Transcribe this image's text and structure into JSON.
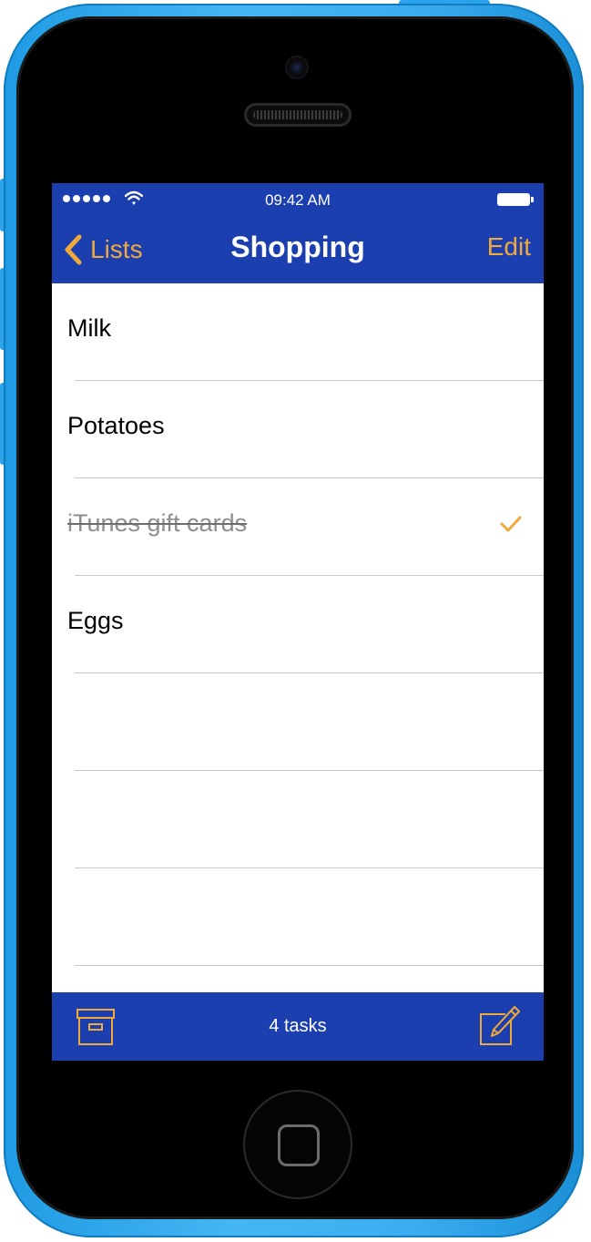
{
  "status_bar": {
    "time": "09:42 AM",
    "signal_icon": "signal-dots-icon",
    "wifi_icon": "wifi-icon",
    "battery_icon": "battery-icon",
    "battery_level": 1.0
  },
  "nav": {
    "back_label": "Lists",
    "back_icon": "chevron-left-icon",
    "title": "Shopping",
    "edit_label": "Edit"
  },
  "tasks": [
    {
      "label": "Milk",
      "completed": false
    },
    {
      "label": "Potatoes",
      "completed": false
    },
    {
      "label": "iTunes gift cards",
      "completed": true
    },
    {
      "label": "Eggs",
      "completed": false
    },
    {
      "label": "",
      "completed": false
    },
    {
      "label": "",
      "completed": false
    },
    {
      "label": "",
      "completed": false
    }
  ],
  "toolbar": {
    "archive_icon": "archive-box-icon",
    "count_label": "4 tasks",
    "compose_icon": "compose-icon"
  },
  "colors": {
    "bar_background": "#1c3fb0",
    "accent": "#f0a93b",
    "phone_body": "#3aaef0"
  }
}
